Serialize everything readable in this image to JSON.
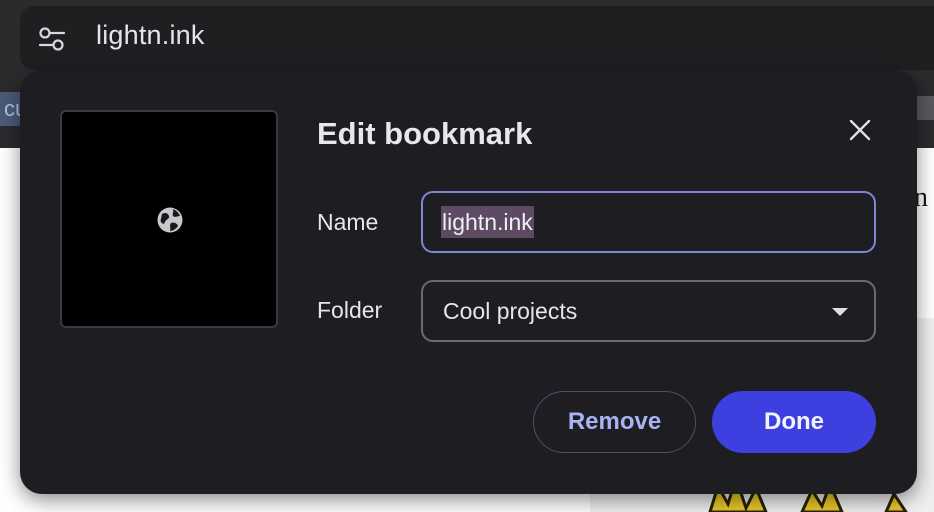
{
  "omnibox": {
    "url": "lightn.ink",
    "icon": "tune-icon"
  },
  "bookmarks_bar": {
    "partial_item": "cu"
  },
  "page": {
    "partial_letter": "n"
  },
  "dialog": {
    "title": "Edit bookmark",
    "close_icon": "close-icon",
    "thumbnail_icon": "globe-icon",
    "name_label": "Name",
    "name_value": "lightn.ink",
    "folder_label": "Folder",
    "folder_value": "Cool projects",
    "remove_label": "Remove",
    "done_label": "Done"
  },
  "colors": {
    "dialog_bg": "#1d1d22",
    "accent": "#3d40de",
    "focus_ring": "#7e86d8",
    "remove_text": "#a8b3f6",
    "selection": "#5d4b63"
  }
}
